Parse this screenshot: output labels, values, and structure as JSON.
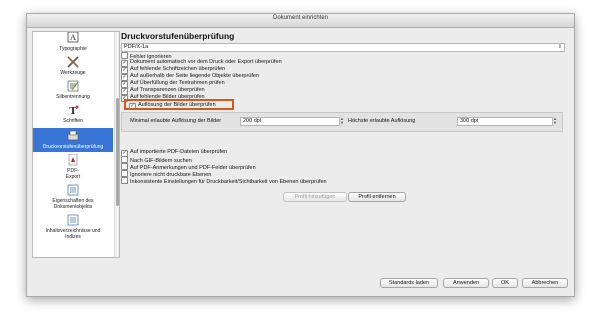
{
  "window": {
    "title": "Dokument einrichten"
  },
  "sidebar": {
    "items": [
      {
        "label": "Typographie",
        "icon": "typography-icon"
      },
      {
        "label": "Werkzeuge",
        "icon": "tools-icon"
      },
      {
        "label": "Silbentrennung",
        "icon": "hyphenation-icon"
      },
      {
        "label": "Schriften",
        "icon": "fonts-icon"
      },
      {
        "label": "Druckvorstufenüberprüfung",
        "icon": "preflight-icon",
        "selected": true
      },
      {
        "label": "PDF-Export",
        "icon": "pdf-export-icon"
      },
      {
        "label": "Eigenschaften des Dokumentobjekts",
        "icon": "document-properties-icon"
      },
      {
        "label": "Inhaltsverzeichnisse und Indizes",
        "icon": "toc-icon"
      }
    ]
  },
  "main": {
    "heading": "Druckvorstufenüberprüfung",
    "profile": "PDF/X-1a",
    "checks": [
      {
        "label": "Fehler ignorieren",
        "checked": false
      },
      {
        "label": "Dokument automatisch vor dem Druck oder Export überprüfen",
        "checked": true
      },
      {
        "label": "Auf fehlende Schriftzeichen überprüfen",
        "checked": true
      },
      {
        "label": "Auf außerhalb der Seite liegende Objekte überprüfen",
        "checked": true
      },
      {
        "label": "Auf Überfüllung der Textrahmen prüfen",
        "checked": true
      },
      {
        "label": "Auf Transparenzen überprüfen",
        "checked": true
      },
      {
        "label": "Auf fehlende Bilder überprüfen",
        "checked": true
      },
      {
        "label": "Auflösung der Bilder überprüfen",
        "checked": true
      }
    ],
    "resolution": {
      "min_label": "Minimal erlaubte Auflösung der Bilder",
      "min_value": "200 dpi",
      "max_label": "Höchste erlaubte Auflösung",
      "max_value": "300 dpi"
    },
    "checks2": [
      {
        "label": "Auf importierte PDF-Dateien überprüfen",
        "checked": true
      },
      {
        "label": "Nach GIF-Bildern suchen",
        "checked": false
      },
      {
        "label": "Auf PDF-Anmerkungen und PDF-Felder überprüfen",
        "checked": false
      },
      {
        "label": "Ignoriere nicht druckbare Ebenen",
        "checked": false
      },
      {
        "label": "Inkonsistente Einstellungen für Druckbarkeit/Sichtbarkeit von Ebenen überprüfen",
        "checked": false
      }
    ],
    "add_profile": "Profil hinzufügen",
    "remove_profile": "Profil entfernen"
  },
  "footer": {
    "defaults": "Standards laden",
    "apply": "Anwenden",
    "ok": "OK",
    "cancel": "Abbrechen"
  },
  "colors": {
    "highlight": "#d35a1d",
    "selection": "#3875d7"
  }
}
